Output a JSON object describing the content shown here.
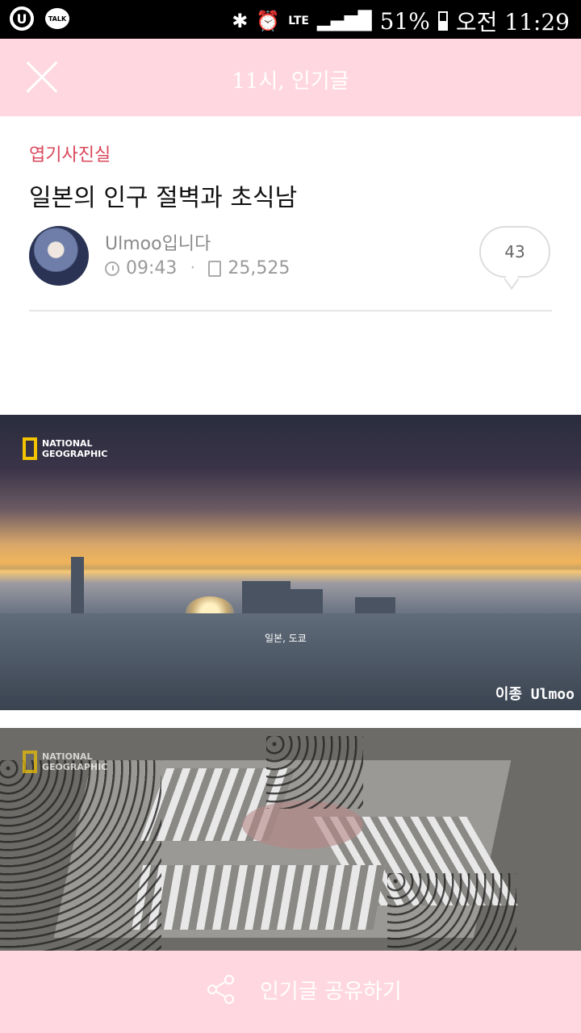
{
  "status_bar": {
    "left_icons": [
      "u-icon",
      "kakaotalk-icon"
    ],
    "talk_label": "TALK",
    "u_label": "U",
    "network": "LTE",
    "battery": "51%",
    "time": "오전 11:29"
  },
  "toolbar": {
    "title": "11시, 인기글"
  },
  "post": {
    "category": "엽기사진실",
    "title": "일본의 인구 절벽과 초식남",
    "author": "Ulmoo입니다",
    "time": "09:43",
    "views": "25,525",
    "comments": "43"
  },
  "images": [
    {
      "logo": [
        "NATIONAL",
        "GEOGRAPHIC"
      ],
      "caption": "일본, 도쿄",
      "watermark": "이종 Ulmoo"
    },
    {
      "logo": [
        "NATIONAL",
        "GEOGRAPHIC"
      ]
    }
  ],
  "bottom_bar": {
    "share_label": "인기글 공유하기"
  },
  "colors": {
    "toolbar_bg": "#ffd7e0",
    "category": "#d9475a"
  }
}
